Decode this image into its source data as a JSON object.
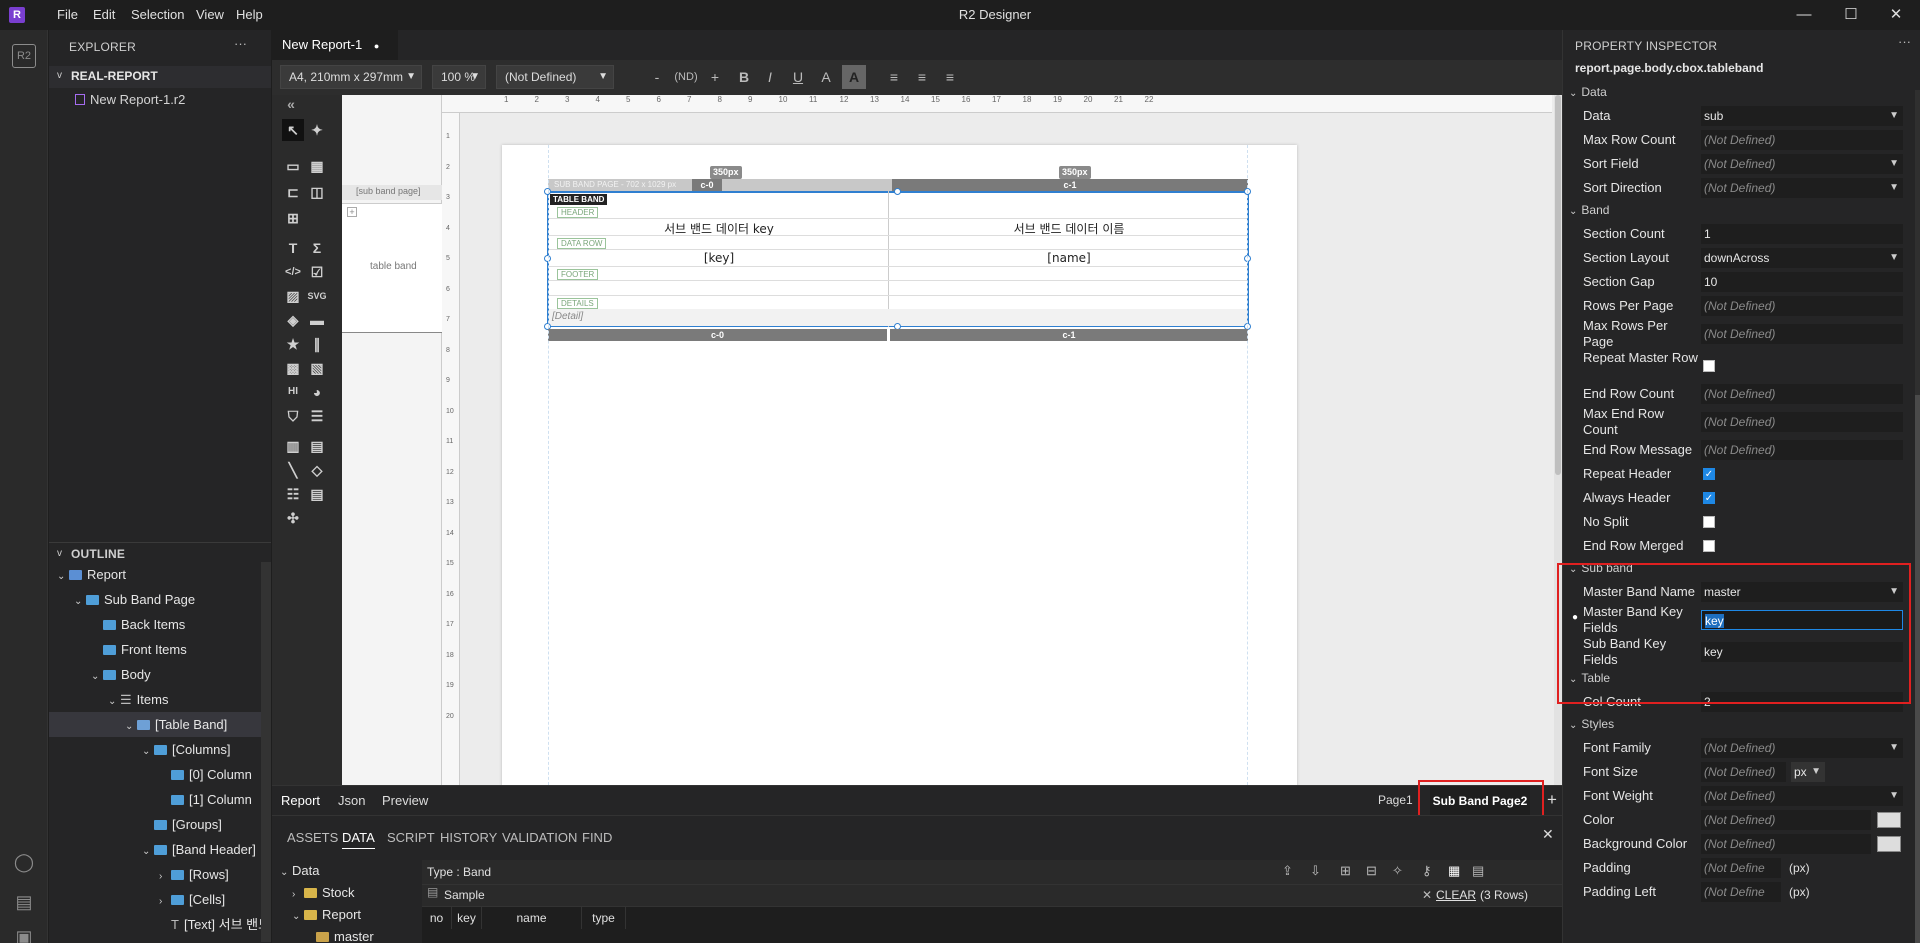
{
  "app": {
    "title": "R2 Designer",
    "logo_letter": "R",
    "menu": [
      "File",
      "Edit",
      "Selection",
      "View",
      "Help"
    ],
    "window_controls": [
      "minimize",
      "maximize",
      "close"
    ]
  },
  "explorer": {
    "header": "EXPLORER",
    "project": "REAL-REPORT",
    "file": "New Report-1.r2",
    "outline_header": "OUTLINE",
    "outline": [
      {
        "label": "Report",
        "depth": 0,
        "chev": "v",
        "icon": "report"
      },
      {
        "label": "Sub Band Page",
        "depth": 1,
        "chev": "v",
        "icon": "folder"
      },
      {
        "label": "Back Items",
        "depth": 2,
        "chev": "",
        "icon": "folder"
      },
      {
        "label": "Front Items",
        "depth": 2,
        "chev": "",
        "icon": "folder"
      },
      {
        "label": "Body",
        "depth": 2,
        "chev": "v",
        "icon": "folder"
      },
      {
        "label": "Items",
        "depth": 3,
        "chev": "v",
        "icon": "list"
      },
      {
        "label": "[Table Band]",
        "depth": 4,
        "chev": "v",
        "icon": "table",
        "selected": true
      },
      {
        "label": "[Columns]",
        "depth": 5,
        "chev": "v",
        "icon": "folder"
      },
      {
        "label": "[0] Column",
        "depth": 6,
        "chev": "",
        "icon": "folder"
      },
      {
        "label": "[1] Column",
        "depth": 6,
        "chev": "",
        "icon": "folder"
      },
      {
        "label": "[Groups]",
        "depth": 5,
        "chev": "",
        "icon": "folder"
      },
      {
        "label": "[Band Header]",
        "depth": 5,
        "chev": "v",
        "icon": "folder"
      },
      {
        "label": "[Rows]",
        "depth": 6,
        "chev": ">",
        "icon": "folder"
      },
      {
        "label": "[Cells]",
        "depth": 6,
        "chev": ">",
        "icon": "folder"
      },
      {
        "label": "[Text] 서브 밴드 ...",
        "depth": 6,
        "chev": "",
        "icon": "text"
      }
    ]
  },
  "document": {
    "tab_label": "New Report-1",
    "modified_marker": "●",
    "page_size": "A4, 210mm x 297mm",
    "zoom": "100",
    "zoom_unit": "%",
    "font_select": "(Not Defined)",
    "font_size_minus": "-",
    "font_size_value": "(ND)",
    "font_size_plus": "+"
  },
  "canvas": {
    "band_label_sub": "[sub band page]",
    "band_label_table": "table band",
    "page_header_text": "SUB BAND PAGE - 702 x 1029 px",
    "col_width_labels": [
      "350px",
      "350px"
    ],
    "columns": [
      "c-0",
      "c-1"
    ],
    "table_band_tag": "TABLE BAND",
    "header_tag": "HEADER",
    "data_row_tag": "DATA ROW",
    "footer_tag": "FOOTER",
    "details_tag": "DETAILS",
    "header_cells": [
      "서브 밴드 데이터 key",
      "서브 밴드 데이터 이름"
    ],
    "data_cells": [
      "[key]",
      "[name]"
    ],
    "detail_text": "[Detail]",
    "ruler_marks": [
      "1",
      "2",
      "3",
      "4",
      "5",
      "6",
      "7",
      "8",
      "9",
      "10",
      "11",
      "12",
      "13",
      "14",
      "15",
      "16",
      "17",
      "18",
      "19",
      "20",
      "21",
      "22"
    ]
  },
  "view_tabs": {
    "items": [
      "Report",
      "Json",
      "Preview"
    ],
    "pages": [
      "Page1",
      "Sub Band Page2"
    ],
    "add": "+"
  },
  "bottom_panel": {
    "tabs": [
      "ASSETS",
      "DATA",
      "SCRIPT",
      "HISTORY",
      "VALIDATION",
      "FIND"
    ],
    "active_tab": "DATA",
    "data_tree": [
      {
        "label": "Data",
        "depth": 0,
        "chev": "v"
      },
      {
        "label": "Stock",
        "depth": 1,
        "chev": ">"
      },
      {
        "label": "Report",
        "depth": 1,
        "chev": "v"
      },
      {
        "label": "master",
        "depth": 2,
        "chev": ""
      }
    ],
    "type_label": "Type : Band",
    "sample_label": "Sample",
    "clear_label": "CLEAR",
    "rows_count": "(3 Rows)",
    "grid_columns": [
      "no",
      "key",
      "name",
      "type"
    ]
  },
  "inspector": {
    "header": "PROPERTY INSPECTOR",
    "path": "report.page.body.cbox.tableband",
    "sections": [
      {
        "title": "Data",
        "rows": [
          {
            "label": "Data",
            "value": "sub",
            "type": "select"
          },
          {
            "label": "Max Row Count",
            "value": "(Not Defined)",
            "type": "nd"
          },
          {
            "label": "Sort Field",
            "value": "(Not Defined)",
            "type": "nd-select"
          },
          {
            "label": "Sort Direction",
            "value": "(Not Defined)",
            "type": "nd-select"
          }
        ]
      },
      {
        "title": "Band",
        "rows": [
          {
            "label": "Section Count",
            "value": "1",
            "type": "text"
          },
          {
            "label": "Section Layout",
            "value": "downAcross",
            "type": "select"
          },
          {
            "label": "Section Gap",
            "value": "10",
            "type": "text"
          },
          {
            "label": "Rows Per Page",
            "value": "(Not Defined)",
            "type": "nd"
          },
          {
            "label": "Max Rows Per Page",
            "value": "(Not Defined)",
            "type": "nd"
          },
          {
            "label": "Repeat Master Row",
            "value": "",
            "type": "check"
          },
          {
            "label": "End Row Count",
            "value": "(Not Defined)",
            "type": "nd"
          },
          {
            "label": "Max End Row Count",
            "value": "(Not Defined)",
            "type": "nd"
          },
          {
            "label": "End Row Message",
            "value": "(Not Defined)",
            "type": "nd"
          },
          {
            "label": "Repeat Header",
            "value": "",
            "type": "check-on"
          },
          {
            "label": "Always Header",
            "value": "",
            "type": "check-on"
          },
          {
            "label": "No Split",
            "value": "",
            "type": "check"
          },
          {
            "label": "End Row Merged",
            "value": "",
            "type": "check"
          }
        ]
      },
      {
        "title": "Sub band",
        "rows": [
          {
            "label": "Master Band Name",
            "value": "master",
            "type": "select"
          },
          {
            "label": "Master Band Key Fields",
            "value": "key",
            "type": "focus"
          },
          {
            "label": "Sub Band Key Fields",
            "value": "key",
            "type": "text"
          }
        ]
      },
      {
        "title": "Table",
        "rows": [
          {
            "label": "Col Count",
            "value": "2",
            "type": "text"
          }
        ]
      },
      {
        "title": "Styles",
        "rows": [
          {
            "label": "Font Family",
            "value": "(Not Defined)",
            "type": "nd-select"
          },
          {
            "label": "Font Size",
            "value": "(Not Defined)",
            "type": "nd-unit",
            "unit": "px"
          },
          {
            "label": "Font Weight",
            "value": "(Not Defined)",
            "type": "nd-select"
          },
          {
            "label": "Color",
            "value": "(Not Defined)",
            "type": "nd-color"
          },
          {
            "label": "Background Color",
            "value": "(Not Defined)",
            "type": "nd-color"
          },
          {
            "label": "Padding",
            "value": "(Not Define",
            "type": "nd-px",
            "unit": "(px)"
          },
          {
            "label": "Padding Left",
            "value": "(Not Define",
            "type": "nd-px",
            "unit": "(px)"
          }
        ]
      }
    ]
  },
  "colors": {
    "accent": "#1e88e5",
    "highlight_box": "#e02020",
    "band_outline": "#2f7fd0",
    "folder": "#4f9ed8",
    "logo": "#7a3fd0"
  }
}
